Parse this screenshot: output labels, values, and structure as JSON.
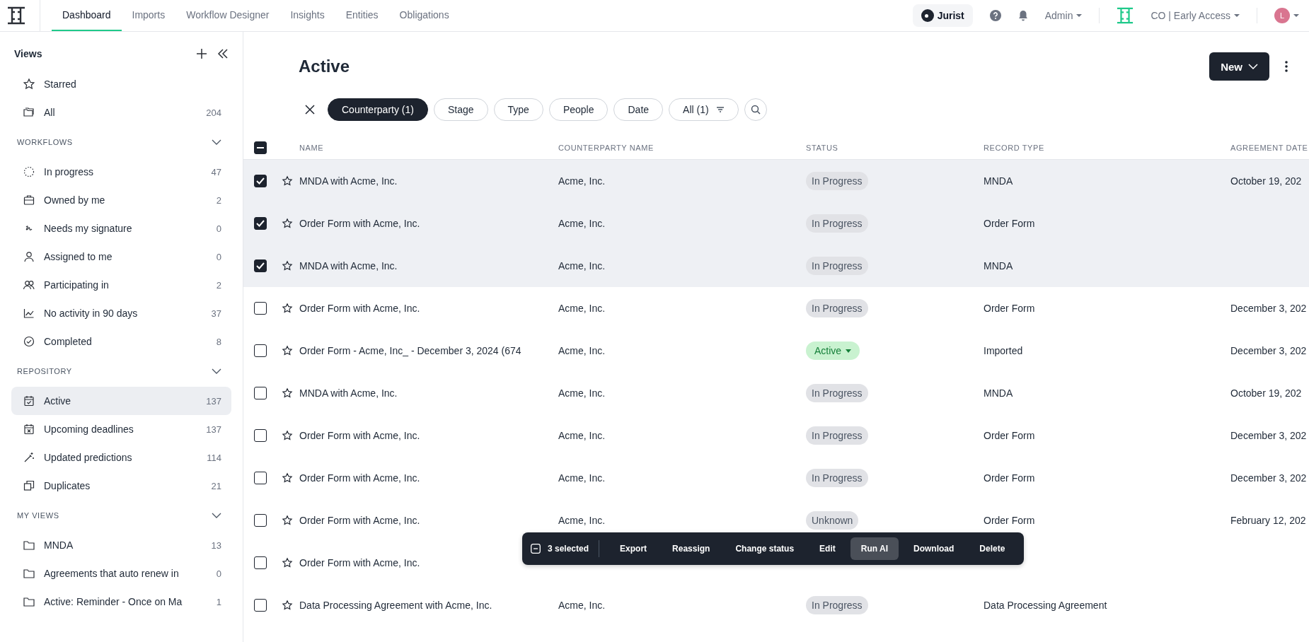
{
  "nav": {
    "tabs": [
      {
        "label": "Dashboard",
        "selected": true
      },
      {
        "label": "Imports",
        "selected": false
      },
      {
        "label": "Workflow Designer",
        "selected": false
      },
      {
        "label": "Insights",
        "selected": false
      },
      {
        "label": "Entities",
        "selected": false
      },
      {
        "label": "Obligations",
        "selected": false
      }
    ],
    "jurist_button": "Jurist",
    "user_menu": "Admin",
    "workspace": "CO | Early Access",
    "avatar_initial": "L"
  },
  "sidebar": {
    "title": "Views",
    "top_items": [
      {
        "label": "Starred",
        "selected": false
      },
      {
        "label": "All",
        "count": "204",
        "selected": false
      }
    ],
    "sections": [
      {
        "heading": "WORKFLOWS",
        "expanded": true,
        "items": [
          {
            "label": "In progress",
            "count": "47",
            "selected": false
          },
          {
            "label": "Owned by me",
            "count": "2",
            "selected": false
          },
          {
            "label": "Needs my signature",
            "count": "0",
            "selected": false
          },
          {
            "label": "Assigned to me",
            "count": "0",
            "selected": false
          },
          {
            "label": "Participating in",
            "count": "2",
            "selected": false
          },
          {
            "label": "No activity in 90 days",
            "count": "37",
            "selected": false
          },
          {
            "label": "Completed",
            "count": "8",
            "selected": false
          }
        ]
      },
      {
        "heading": "REPOSITORY",
        "expanded": true,
        "items": [
          {
            "label": "Active",
            "count": "137",
            "selected": true
          },
          {
            "label": "Upcoming deadlines",
            "count": "137",
            "selected": false
          },
          {
            "label": "Updated predictions",
            "count": "114",
            "selected": false
          },
          {
            "label": "Duplicates",
            "count": "21",
            "selected": false
          }
        ]
      },
      {
        "heading": "MY VIEWS",
        "expanded": true,
        "items": [
          {
            "label": "MNDA",
            "count": "13",
            "selected": false
          },
          {
            "label": "Agreements that auto renew in",
            "count": "0",
            "selected": false
          },
          {
            "label": "Active: Reminder - Once on Ma",
            "count": "1",
            "selected": false
          }
        ]
      }
    ]
  },
  "page_title": "Active",
  "new_button": "New",
  "filters": [
    {
      "label": "Counterparty (1)",
      "selected": true
    },
    {
      "label": "Stage",
      "selected": false
    },
    {
      "label": "Type",
      "selected": false
    },
    {
      "label": "People",
      "selected": false
    },
    {
      "label": "Date",
      "selected": false
    }
  ],
  "all_filter": "All (1)",
  "table": {
    "select_all_mixed": true,
    "columns": [
      "NAME",
      "COUNTERPARTY NAME",
      "STATUS",
      "RECORD TYPE",
      "AGREEMENT DATE"
    ],
    "rows": [
      {
        "checked": true,
        "starred": false,
        "name": "MNDA with Acme, Inc.",
        "counterparty": "Acme, Inc.",
        "status": {
          "label": "In Progress",
          "kind": "neutral"
        },
        "record_type": "MNDA",
        "date": "October 19, 202"
      },
      {
        "checked": true,
        "starred": false,
        "name": "Order Form with Acme, Inc.",
        "counterparty": "Acme, Inc.",
        "status": {
          "label": "In Progress",
          "kind": "neutral"
        },
        "record_type": "Order Form"
      },
      {
        "checked": true,
        "starred": false,
        "name": "MNDA with Acme, Inc.",
        "counterparty": "Acme, Inc.",
        "status": {
          "label": "In Progress",
          "kind": "neutral"
        },
        "record_type": "MNDA"
      },
      {
        "checked": false,
        "starred": false,
        "name": "Order Form with Acme, Inc.",
        "counterparty": "Acme, Inc.",
        "status": {
          "label": "In Progress",
          "kind": "neutral"
        },
        "record_type": "Order Form",
        "date": "December 3, 202"
      },
      {
        "checked": false,
        "starred": false,
        "name": "Order Form - Acme, Inc_ - December 3, 2024 (674",
        "counterparty": "Acme, Inc.",
        "status": {
          "label": "Active",
          "kind": "active"
        },
        "record_type": "Imported",
        "date": "December 3, 202"
      },
      {
        "checked": false,
        "starred": false,
        "name": "MNDA with Acme, Inc.",
        "counterparty": "Acme, Inc.",
        "status": {
          "label": "In Progress",
          "kind": "neutral"
        },
        "record_type": "MNDA",
        "date": "October 19, 202"
      },
      {
        "checked": false,
        "starred": false,
        "name": "Order Form with Acme, Inc.",
        "counterparty": "Acme, Inc.",
        "status": {
          "label": "In Progress",
          "kind": "neutral"
        },
        "record_type": "Order Form",
        "date": "December 3, 202"
      },
      {
        "checked": false,
        "starred": false,
        "name": "Order Form with Acme, Inc.",
        "counterparty": "Acme, Inc.",
        "status": {
          "label": "In Progress",
          "kind": "neutral"
        },
        "record_type": "Order Form",
        "date": "December 3, 202"
      },
      {
        "checked": false,
        "starred": false,
        "name": "Order Form with Acme, Inc.",
        "counterparty": "Acme, Inc.",
        "status": {
          "label": "Unknown",
          "kind": "neutral"
        },
        "record_type": "Order Form",
        "date": "February 12, 202"
      },
      {
        "checked": false,
        "starred": false,
        "name": "Order Form with Acme, Inc."
      },
      {
        "checked": false,
        "starred": false,
        "name": "Data Processing Agreement with Acme, Inc.",
        "counterparty": "Acme, Inc.",
        "status": {
          "label": "In Progress",
          "kind": "neutral"
        },
        "record_type": "Data Processing Agreement"
      }
    ]
  },
  "bulk_bar": {
    "selected_count": "3 selected",
    "actions": [
      {
        "label": "Export",
        "selected": false
      },
      {
        "label": "Reassign",
        "selected": false
      },
      {
        "label": "Change status",
        "selected": false
      },
      {
        "label": "Edit",
        "selected": false
      },
      {
        "label": "Run AI",
        "selected": true
      },
      {
        "label": "Download",
        "selected": false
      },
      {
        "label": "Delete",
        "selected": false
      }
    ]
  }
}
